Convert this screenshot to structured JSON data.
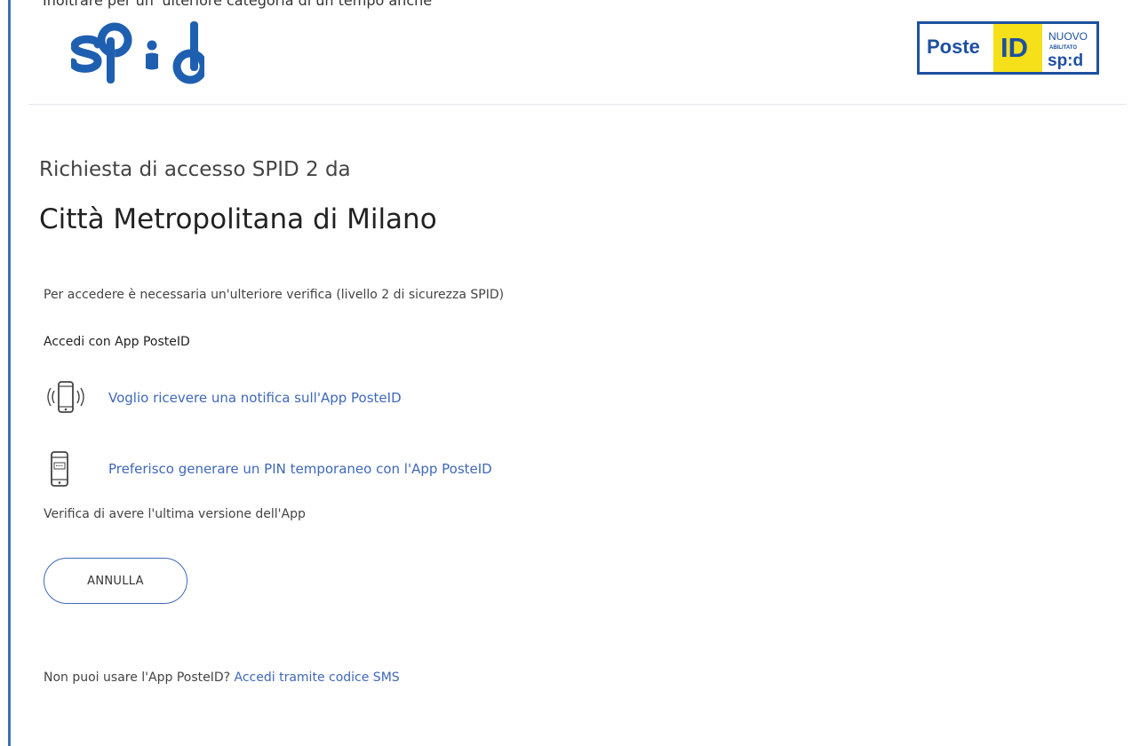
{
  "top_clipped_text": "Inoltrare per un' ulteriore categoria di un tempo anche",
  "header": {
    "spid_logo_text": "sp:d",
    "poste_logo": {
      "poste_text": "Poste",
      "id_text": "ID",
      "nuovo_text": "NUOVO",
      "abilitato_text": "ABILITATO",
      "spid_text": "sp:d"
    }
  },
  "main": {
    "subtitle": "Richiesta di accesso SPID 2 da",
    "title": "Città Metropolitana di Milano",
    "info": "Per accedere è necessaria un'ulteriore verifica (livello 2 di sicurezza SPID)",
    "section_label": "Accedi con App PosteID",
    "options": [
      {
        "icon": "phone-notification-icon",
        "label": "Voglio ricevere una notifica sull'App PosteID"
      },
      {
        "icon": "phone-pin-icon",
        "label": "Preferisco generare un PIN temporaneo con l'App PosteID"
      }
    ],
    "verify_text": "Verifica di avere l'ultima versione dell'App",
    "cancel_button": "ANNULLA"
  },
  "footer": {
    "question": "Non puoi usare l'App PosteID?",
    "sms_link": "Accedi tramite codice SMS"
  },
  "colors": {
    "accent": "#3f68b8",
    "spid_blue": "#1f5fb0",
    "poste_yellow": "#f5e019",
    "poste_blue": "#1e50a0"
  }
}
